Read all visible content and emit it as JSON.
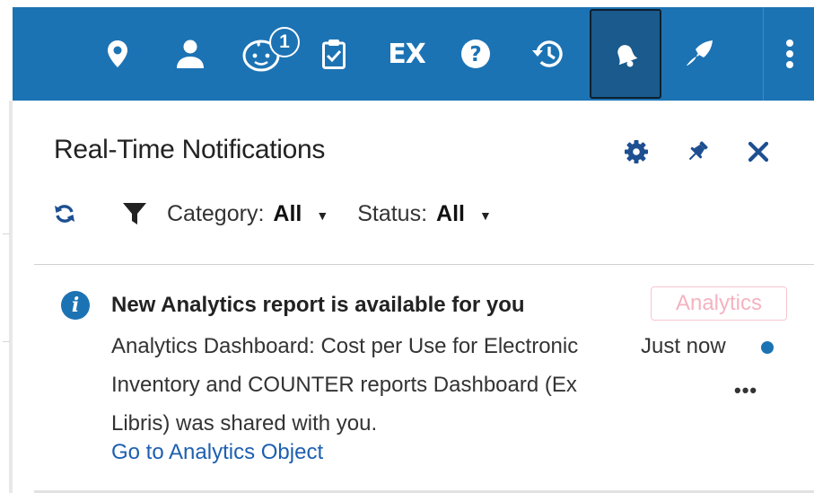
{
  "topbar": {
    "bg_color": "#1c73b4",
    "icons": [
      "location-icon",
      "user-icon",
      "baby-face-icon",
      "clipboard-check-icon",
      "ex-libris-icon",
      "help-icon",
      "history-icon",
      "bell-icon",
      "launch-icon",
      "more-vertical-icon"
    ],
    "baby_badge_count": "1",
    "ex_label": "EX",
    "active_icon": "bell-icon"
  },
  "panel": {
    "title": "Real-Time Notifications",
    "filters": {
      "category_label": "Category:",
      "category_value": "All",
      "status_label": "Status:",
      "status_value": "All"
    }
  },
  "notification": {
    "title": "New Analytics report is available for you",
    "body": "Analytics Dashboard: Cost per Use for Electronic Inventory and COUNTER reports Dashboard (Ex Libris) was shared with you.",
    "link": "Go to Analytics Object",
    "tag": "Analytics",
    "time": "Just now",
    "more": "•••",
    "tag_color": "#f4b3c0",
    "unread_dot_color": "#1c73b4"
  }
}
